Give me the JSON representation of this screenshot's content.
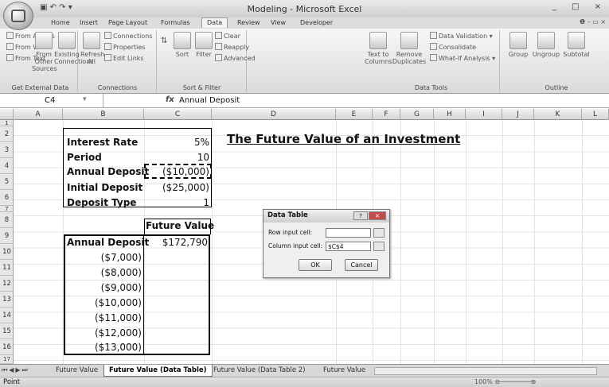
{
  "window": {
    "title": "Modeling - Microsoft Excel",
    "controls": "_ □ ×",
    "qat": "▣ ↶ ↷ ▾"
  },
  "ribbon_tabs": [
    "Home",
    "Insert",
    "Page Layout",
    "Formulas",
    "Data",
    "Review",
    "View",
    "Developer"
  ],
  "active_tab": "Data",
  "ribbon": {
    "get_external": {
      "from_access": "From Access",
      "from_web": "From Web",
      "from_text": "From Text",
      "from_other": "From Other Sources",
      "existing": "Existing Connections",
      "label": "Get External Data"
    },
    "connections": {
      "refresh": "Refresh All",
      "connections": "Connections",
      "properties": "Properties",
      "edit_links": "Edit Links",
      "label": "Connections"
    },
    "sort_filter": {
      "sort": "Sort",
      "filter": "Filter",
      "clear": "Clear",
      "reapply": "Reapply",
      "advanced": "Advanced",
      "label": "Sort & Filter"
    },
    "data_tools": {
      "text_to_columns": "Text to Columns",
      "remove_duplicates": "Remove Duplicates",
      "data_validation": "Data Validation",
      "consolidate": "Consolidate",
      "what_if": "What-If Analysis",
      "label": "Data Tools"
    },
    "outline": {
      "group": "Group",
      "ungroup": "Ungroup",
      "subtotal": "Subtotal",
      "label": "Outline"
    }
  },
  "formula_bar": {
    "name_box": "C4",
    "fx": "fx",
    "content": "Annual Deposit"
  },
  "columns": [
    "A",
    "B",
    "C",
    "D",
    "E",
    "F",
    "G",
    "H",
    "I",
    "J",
    "K",
    "L"
  ],
  "rows": [
    "1",
    "2",
    "3",
    "4",
    "5",
    "6",
    "7",
    "8",
    "9",
    "10",
    "11",
    "12",
    "13",
    "14",
    "15",
    "16",
    "17"
  ],
  "inputs": [
    {
      "label": "Interest Rate",
      "value": "5%"
    },
    {
      "label": "Period",
      "value": "10"
    },
    {
      "label": "Annual Deposit",
      "value": "($10,000)"
    },
    {
      "label": "Initial Deposit",
      "value": "($25,000)"
    },
    {
      "label": "Deposit Type",
      "value": "1"
    }
  ],
  "sheet_title": "The Future Value of an Investment",
  "table": {
    "col_header": "Future Value",
    "row_header": "Annual Deposit",
    "row_header_value": "$172,790",
    "rows": [
      "($7,000)",
      "($8,000)",
      "($9,000)",
      "($10,000)",
      "($11,000)",
      "($12,000)",
      "($13,000)"
    ]
  },
  "dialog": {
    "title": "Data Table",
    "help": "?",
    "close": "×",
    "row_label": "Row input cell:",
    "row_value": "",
    "col_label": "Column input cell:",
    "col_value": "$C$4",
    "ok": "OK",
    "cancel": "Cancel"
  },
  "sheet_tabs": [
    "Future Value",
    "Future Value (Data Table)",
    "Future Value (Data Table 2)",
    "Future Value"
  ],
  "active_sheet": "Future Value (Data Table)",
  "status": {
    "mode": "Point",
    "zoom": "100%"
  }
}
